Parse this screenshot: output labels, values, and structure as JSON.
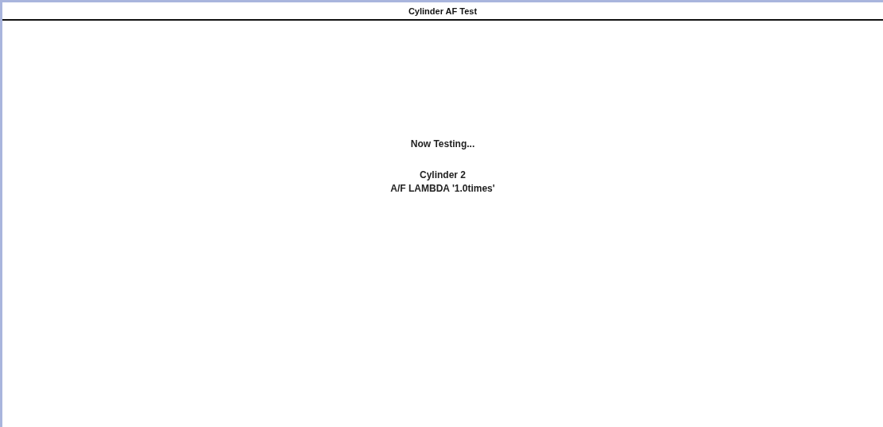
{
  "window": {
    "title": "Cylinder AF Test"
  },
  "status": "Now Testing...",
  "details": [
    "Cylinder 2",
    "A/F LAMBDA '1.0times'"
  ]
}
